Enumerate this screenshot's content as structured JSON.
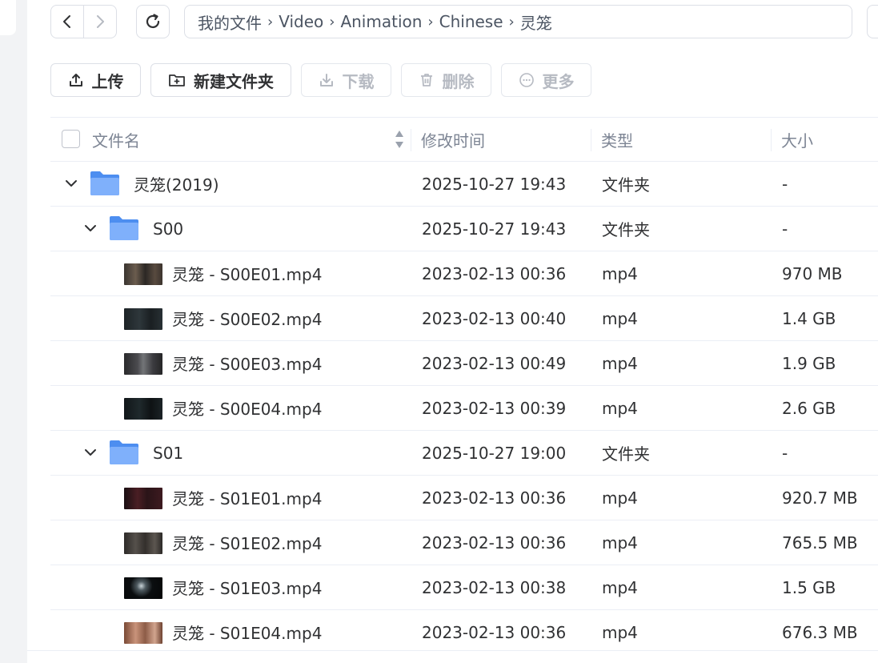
{
  "colors": {
    "accent": "#5f9cf8",
    "border": "#dcdfe6",
    "muted": "#7d8594",
    "disabled": "#b6bac2"
  },
  "breadcrumb": [
    "我的文件",
    "Video",
    "Animation",
    "Chinese",
    "灵笼"
  ],
  "toolbar": {
    "upload": {
      "label": "上传",
      "icon": "upload-icon"
    },
    "new_folder": {
      "label": "新建文件夹",
      "icon": "folder-plus-icon"
    },
    "download": {
      "label": "下载",
      "icon": "download-icon"
    },
    "delete": {
      "label": "删除",
      "icon": "trash-icon"
    },
    "more": {
      "label": "更多",
      "icon": "more-icon"
    }
  },
  "table": {
    "columns": {
      "name": "文件名",
      "modified": "修改时间",
      "type": "类型",
      "size": "大小"
    },
    "rows": [
      {
        "kind": "folder",
        "depth": 0,
        "name": "灵笼(2019)",
        "modified": "2025-10-27 19:43",
        "type": "文件夹",
        "size": "-"
      },
      {
        "kind": "folder",
        "depth": 1,
        "name": "S00",
        "modified": "2025-10-27 19:43",
        "type": "文件夹",
        "size": "-"
      },
      {
        "kind": "file",
        "depth": 2,
        "name": "灵笼 - S00E01.mp4",
        "modified": "2023-02-13 00:36",
        "type": "mp4",
        "size": "970 MB"
      },
      {
        "kind": "file",
        "depth": 2,
        "name": "灵笼 - S00E02.mp4",
        "modified": "2023-02-13 00:40",
        "type": "mp4",
        "size": "1.4 GB"
      },
      {
        "kind": "file",
        "depth": 2,
        "name": "灵笼 - S00E03.mp4",
        "modified": "2023-02-13 00:49",
        "type": "mp4",
        "size": "1.9 GB"
      },
      {
        "kind": "file",
        "depth": 2,
        "name": "灵笼 - S00E04.mp4",
        "modified": "2023-02-13 00:39",
        "type": "mp4",
        "size": "2.6 GB"
      },
      {
        "kind": "folder",
        "depth": 1,
        "name": "S01",
        "modified": "2025-10-27 19:00",
        "type": "文件夹",
        "size": "-"
      },
      {
        "kind": "file",
        "depth": 2,
        "name": "灵笼 - S01E01.mp4",
        "modified": "2023-02-13 00:36",
        "type": "mp4",
        "size": "920.7 MB"
      },
      {
        "kind": "file",
        "depth": 2,
        "name": "灵笼 - S01E02.mp4",
        "modified": "2023-02-13 00:36",
        "type": "mp4",
        "size": "765.5 MB"
      },
      {
        "kind": "file",
        "depth": 2,
        "name": "灵笼 - S01E03.mp4",
        "modified": "2023-02-13 00:38",
        "type": "mp4",
        "size": "1.5 GB"
      },
      {
        "kind": "file",
        "depth": 2,
        "name": "灵笼 - S01E04.mp4",
        "modified": "2023-02-13 00:36",
        "type": "mp4",
        "size": "676.3 MB"
      }
    ]
  }
}
